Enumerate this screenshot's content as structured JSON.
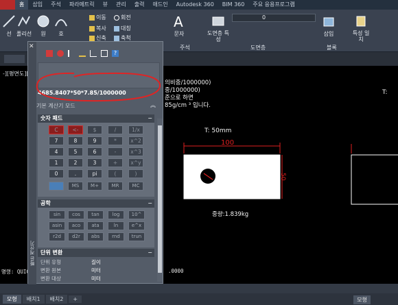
{
  "ribbon": {
    "tabs": [
      "홈",
      "삽입",
      "주석",
      "파라메트릭",
      "뷰",
      "관리",
      "출력",
      "애드인",
      "Autodesk 360",
      "BIM 360",
      "주요 응용프로그램"
    ],
    "active_tab": "홈",
    "draw_tools": [
      "선",
      "폴리선",
      "원",
      "호"
    ],
    "modify_tools": [
      "이동",
      "회전",
      "복사",
      "대칭",
      "신축",
      "축척"
    ],
    "text_label": "문자",
    "dim_label": "도면층 특성",
    "insert_label": "삽입",
    "match_label": "특성 일치",
    "groups": [
      "주석",
      "도면층",
      "블록"
    ],
    "layer_value": "0"
  },
  "view_label": "-][평면도][",
  "drawing": {
    "notes": [
      "의비중/1000000)",
      "중/1000000)",
      "준으로 하면",
      "85g/cm ³ 입니다."
    ],
    "t_label": "T:   50mm",
    "t_label_right": "T:",
    "width_dim": "100",
    "height_dim": "50",
    "weight": "중량:1.839kg",
    "colors": {
      "dim": "#e02020",
      "outline": "#ffffff",
      "panel": "#ffffff"
    }
  },
  "quickcalc": {
    "title": "빠른 계산기",
    "input": "4685.8407*50*7.85/1000000",
    "basic_label": "기본 계산기 모드",
    "numpad": {
      "title": "숫자 패드",
      "keys": [
        [
          "C",
          "<-",
          "$",
          "/",
          "1/x"
        ],
        [
          "7",
          "8",
          "9",
          "*",
          "x^2"
        ],
        [
          "4",
          "5",
          "6",
          "-",
          "x^3"
        ],
        [
          "1",
          "2",
          "3",
          "+",
          "x^y"
        ],
        [
          "0",
          ".",
          "pi",
          "(",
          ")"
        ]
      ],
      "memory": [
        "MS",
        "M+",
        "MR",
        "MC"
      ]
    },
    "sci": {
      "title": "공학",
      "keys": [
        [
          "sin",
          "cos",
          "tan",
          "log",
          "10^"
        ],
        [
          "asin",
          "aco",
          "ata",
          "ln",
          "e^x"
        ],
        [
          "r2d",
          "d2r",
          "abs",
          "rnd",
          "trun"
        ]
      ]
    },
    "units": {
      "title": "단위 변환",
      "rows": [
        {
          "label": "단위 유형",
          "value": "길이"
        },
        {
          "label": "변환 원본",
          "value": "미터"
        },
        {
          "label": "변환 대상",
          "value": "미터"
        }
      ]
    }
  },
  "command": {
    "prefix": "명령: QUICK",
    "value": ".0000"
  },
  "layout_tabs": [
    "모형",
    "배치1",
    "배치2",
    "+"
  ],
  "model_button": "모형"
}
